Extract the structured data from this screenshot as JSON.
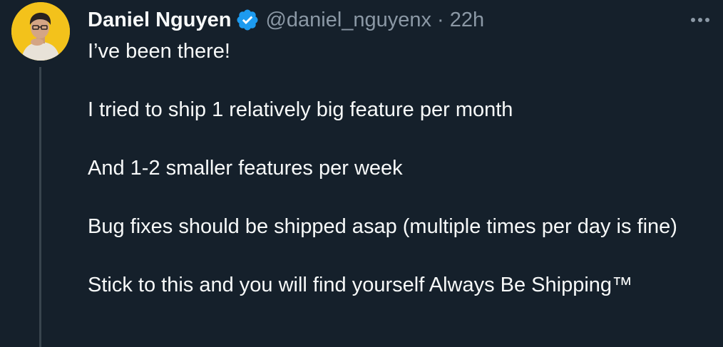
{
  "author": {
    "name": "Daniel Nguyen",
    "handle": "@daniel_nguyenx",
    "separator": "·",
    "time": "22h",
    "verified": true,
    "verified_color": "#1d9bf0"
  },
  "tweet": {
    "paragraphs": [
      "I’ve been there!",
      "I tried to ship 1 relatively big feature per month",
      "And 1-2 smaller features per week",
      "Bug fixes should be shipped asap (multiple times per day is fine)",
      "Stick to this and you will find yourself Always Be Shipping™"
    ]
  },
  "icons": {
    "verified": "verified-badge-icon",
    "more": "more-options-icon"
  },
  "colors": {
    "background": "#15202b",
    "text_primary": "#f7f9f9",
    "text_secondary": "#8b98a5",
    "thread_line": "#38444d",
    "avatar_bg": "#f3c21b"
  }
}
